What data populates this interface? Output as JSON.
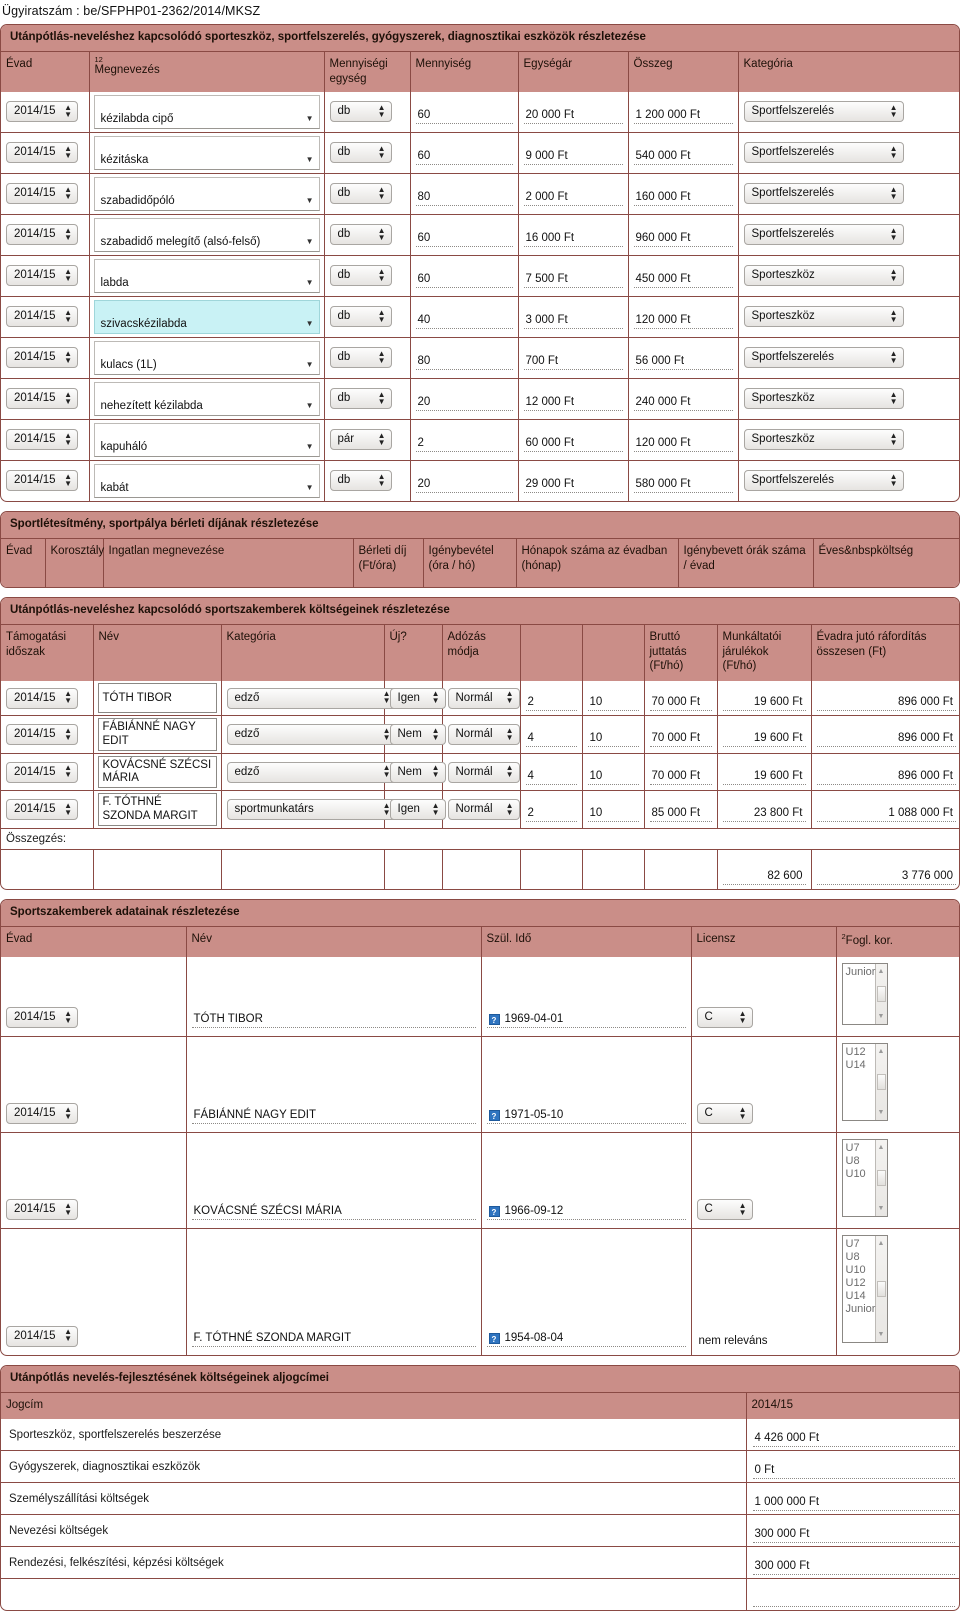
{
  "document": {
    "case_number_label": "Ügyiratszám : be/SFPHP01-2362/2014/MKSZ"
  },
  "equipment_section": {
    "title": "Utánpótlás-neveléshez kapcsolódó sporteszköz, sportfelszerelés, gyógyszerek, diagnosztikai eszközök részletezése",
    "columns": {
      "evad": "Évad",
      "megnevezes_sup": "12",
      "megnevezes": "Megnevezés",
      "mennyisegi_egyseg": "Mennyiségi egység",
      "mennyiseg": "Mennyiség",
      "egysegar": "Egységár",
      "osszeg": "Összeg",
      "kategoria": "Kategória"
    },
    "rows": [
      {
        "evad": "2014/15",
        "megnevezes": "kézilabda cipő",
        "egyseg": "db",
        "mennyiseg": "60",
        "egysegar": "20 000 Ft",
        "osszeg": "1 200 000  Ft",
        "kategoria": "Sportfelszerelés",
        "highlight": false
      },
      {
        "evad": "2014/15",
        "megnevezes": "kézitáska",
        "egyseg": "db",
        "mennyiseg": "60",
        "egysegar": "9 000 Ft",
        "osszeg": "540 000  Ft",
        "kategoria": "Sportfelszerelés",
        "highlight": false
      },
      {
        "evad": "2014/15",
        "megnevezes": "szabadidőpóló",
        "egyseg": "db",
        "mennyiseg": "80",
        "egysegar": "2 000 Ft",
        "osszeg": "160 000  Ft",
        "kategoria": "Sportfelszerelés",
        "highlight": false
      },
      {
        "evad": "2014/15",
        "megnevezes": "szabadidő melegítő (alsó-felső)",
        "egyseg": "db",
        "mennyiseg": "60",
        "egysegar": "16 000 Ft",
        "osszeg": "960 000  Ft",
        "kategoria": "Sportfelszerelés",
        "highlight": false
      },
      {
        "evad": "2014/15",
        "megnevezes": "labda",
        "egyseg": "db",
        "mennyiseg": "60",
        "egysegar": "7 500 Ft",
        "osszeg": "450 000  Ft",
        "kategoria": "Sporteszköz",
        "highlight": false
      },
      {
        "evad": "2014/15",
        "megnevezes": "szivacskézilabda",
        "egyseg": "db",
        "mennyiseg": "40",
        "egysegar": "3 000 Ft",
        "osszeg": "120 000  Ft",
        "kategoria": "Sporteszköz",
        "highlight": true
      },
      {
        "evad": "2014/15",
        "megnevezes": "kulacs (1L)",
        "egyseg": "db",
        "mennyiseg": "80",
        "egysegar": "700 Ft",
        "osszeg": "56 000  Ft",
        "kategoria": "Sportfelszerelés",
        "highlight": false
      },
      {
        "evad": "2014/15",
        "megnevezes": "nehezített kézilabda",
        "egyseg": "db",
        "mennyiseg": "20",
        "egysegar": "12 000 Ft",
        "osszeg": "240 000  Ft",
        "kategoria": "Sporteszköz",
        "highlight": false
      },
      {
        "evad": "2014/15",
        "megnevezes": "kapuháló",
        "egyseg": "pár",
        "mennyiseg": "2",
        "egysegar": "60 000 Ft",
        "osszeg": "120 000  Ft",
        "kategoria": "Sporteszköz",
        "highlight": false
      },
      {
        "evad": "2014/15",
        "megnevezes": "kabát",
        "egyseg": "db",
        "mennyiseg": "20",
        "egysegar": "29 000 Ft",
        "osszeg": "580 000  Ft",
        "kategoria": "Sportfelszerelés",
        "highlight": false
      }
    ]
  },
  "facility_section": {
    "title": "Sportlétesítmény, sportpálya bérleti díjának részletezése",
    "columns": {
      "evad": "Évad",
      "korosztaly": "Korosztály",
      "ingatlan": "Ingatlan megnevezése",
      "berleti_dij": "Bérleti díj (Ft/óra)",
      "igenybevetel": "Igénybevétel (óra / hó)",
      "honapok": "Hónapok száma az évadban (hónap)",
      "igenybevett_orak": "Igénybevett órák száma / évad",
      "eves_koltseg": "Éves&nbspköltség"
    }
  },
  "staff_cost_section": {
    "title": "Utánpótlás-neveléshez kapcsolódó sportszakemberek költségeinek részletezése",
    "columns": {
      "tamogatasi_idoszak": "Támogatási időszak",
      "nev": "Név",
      "kategoria": "Kategória",
      "uj": "Új?",
      "adozas": "Adózás módja",
      "blank1": "",
      "blank2": "",
      "brutto": "Bruttó juttatás (Ft/hó)",
      "jarulekok": "Munkáltatói járulékok (Ft/hó)",
      "evadra": "Évadra jutó ráfordítás összesen (Ft)"
    },
    "rows": [
      {
        "idoszak": "2014/15",
        "nev": "TÓTH TIBOR",
        "kategoria": "edző",
        "uj": "Igen",
        "adozas": "Normál",
        "c1": "2",
        "c2": "10",
        "brutto": "70 000 Ft",
        "jarulekok": "19 600  Ft",
        "evadra": "896 000  Ft"
      },
      {
        "idoszak": "2014/15",
        "nev": "FÁBIÁNNÉ NAGY EDIT",
        "kategoria": "edző",
        "uj": "Nem",
        "adozas": "Normál",
        "c1": "4",
        "c2": "10",
        "brutto": "70 000 Ft",
        "jarulekok": "19 600  Ft",
        "evadra": "896 000  Ft"
      },
      {
        "idoszak": "2014/15",
        "nev": "KOVÁCSNÉ SZÉCSI MÁRIA",
        "kategoria": "edző",
        "uj": "Nem",
        "adozas": "Normál",
        "c1": "4",
        "c2": "10",
        "brutto": "70 000 Ft",
        "jarulekok": "19 600  Ft",
        "evadra": "896 000  Ft"
      },
      {
        "idoszak": "2014/15",
        "nev": "F. TÓTHNÉ SZONDA MARGIT",
        "kategoria": "sportmunkatárs",
        "uj": "Igen",
        "adozas": "Normál",
        "c1": "2",
        "c2": "10",
        "brutto": "85 000 Ft",
        "jarulekok": "23 800  Ft",
        "evadra": "1 088 000  Ft"
      }
    ],
    "summary_label": "Összegzés:",
    "summary": {
      "jarulekok": "82 600",
      "evadra": "3 776 000"
    }
  },
  "staff_data_section": {
    "title": "Sportszakemberek adatainak részletezése",
    "columns": {
      "evad": "Évad",
      "nev": "Név",
      "szul_ido": "Szül. Idő",
      "licensz": "Licensz",
      "fogl_kor_sup": "2",
      "fogl_kor": "Fogl. kor."
    },
    "rows": [
      {
        "evad": "2014/15",
        "nev": "TÓTH TIBOR",
        "szul_ido": "1969-04-01",
        "licensz": "C",
        "licensz_is_select": true,
        "fogl_kor": [
          "Junior"
        ]
      },
      {
        "evad": "2014/15",
        "nev": "FÁBIÁNNÉ NAGY EDIT",
        "szul_ido": "1971-05-10",
        "licensz": "C",
        "licensz_is_select": true,
        "fogl_kor": [
          "U12",
          "U14"
        ]
      },
      {
        "evad": "2014/15",
        "nev": "KOVÁCSNÉ SZÉCSI MÁRIA",
        "szul_ido": "1966-09-12",
        "licensz": "C",
        "licensz_is_select": true,
        "fogl_kor": [
          "U7",
          "U8",
          "U10"
        ]
      },
      {
        "evad": "2014/15",
        "nev": "F. TÓTHNÉ SZONDA MARGIT",
        "szul_ido": "1954-08-04",
        "licensz": "nem releváns",
        "licensz_is_select": false,
        "fogl_kor": [
          "U7",
          "U8",
          "U10",
          "U12",
          "U14",
          "Junior"
        ]
      }
    ]
  },
  "subtitles_section": {
    "title": "Utánpótlás nevelés-fejlesztésének költségeinek aljogcímei",
    "columns": {
      "jogcim": "Jogcím",
      "year": "2014/15"
    },
    "rows": [
      {
        "jogcim": "Sporteszköz, sportfelszerelés beszerzése",
        "value": "4 426 000  Ft"
      },
      {
        "jogcim": "Gyógyszerek, diagnosztikai eszközök",
        "value": "0  Ft"
      },
      {
        "jogcim": "Személyszállítási költségek",
        "value": "1 000 000 Ft"
      },
      {
        "jogcim": "Nevezési költségek",
        "value": "300 000 Ft"
      },
      {
        "jogcim": "Rendezési, felkészítési, képzési költségek",
        "value": "300 000 Ft"
      },
      {
        "jogcim": "",
        "value": ""
      }
    ]
  },
  "icons": {
    "updown": "up-down-arrows",
    "caret": "chevron-down-icon",
    "help": "?"
  },
  "colors": {
    "header_pink": "#ca8e88",
    "border_maroon": "#8a4a44",
    "highlight_cyan": "#c9f2f5",
    "help_blue": "#2f74c0"
  }
}
